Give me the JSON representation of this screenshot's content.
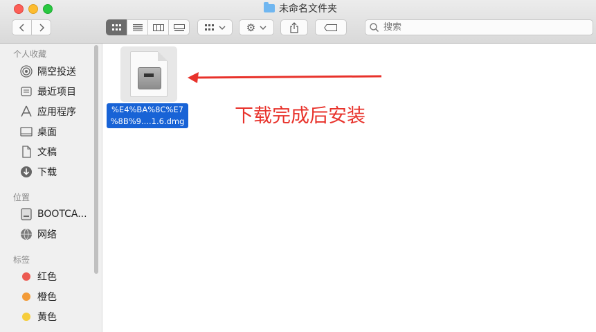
{
  "window": {
    "title": "未命名文件夹"
  },
  "toolbar": {
    "nav": {
      "back_icon": "chevron-left-icon",
      "forward_icon": "chevron-right-icon"
    },
    "view_modes": [
      "icon-view",
      "list-view",
      "column-view",
      "gallery-view"
    ],
    "active_view": "icon-view",
    "search": {
      "placeholder": "搜索"
    }
  },
  "sidebar": {
    "sections": [
      {
        "title": "个人收藏",
        "items": [
          {
            "label": "隔空投送",
            "icon": "airdrop-icon"
          },
          {
            "label": "最近项目",
            "icon": "recents-icon"
          },
          {
            "label": "应用程序",
            "icon": "applications-icon"
          },
          {
            "label": "桌面",
            "icon": "desktop-icon"
          },
          {
            "label": "文稿",
            "icon": "documents-icon"
          },
          {
            "label": "下载",
            "icon": "downloads-icon"
          }
        ]
      },
      {
        "title": "位置",
        "items": [
          {
            "label": "BOOTCA...",
            "icon": "disk-icon"
          },
          {
            "label": "网络",
            "icon": "network-icon"
          }
        ]
      },
      {
        "title": "标签",
        "items": [
          {
            "label": "红色",
            "color": "#ec5a51"
          },
          {
            "label": "橙色",
            "color": "#f29b38"
          },
          {
            "label": "黄色",
            "color": "#f6cd3c"
          }
        ]
      }
    ]
  },
  "content": {
    "file": {
      "name_line1": "%E4%BA%8C%E7",
      "name_line2": "%8B%9....1.6.dmg",
      "icon": "disk-image-icon"
    },
    "annotation": "下载完成后安装",
    "accent": "#e8322b",
    "selection_color": "#1863d6"
  }
}
